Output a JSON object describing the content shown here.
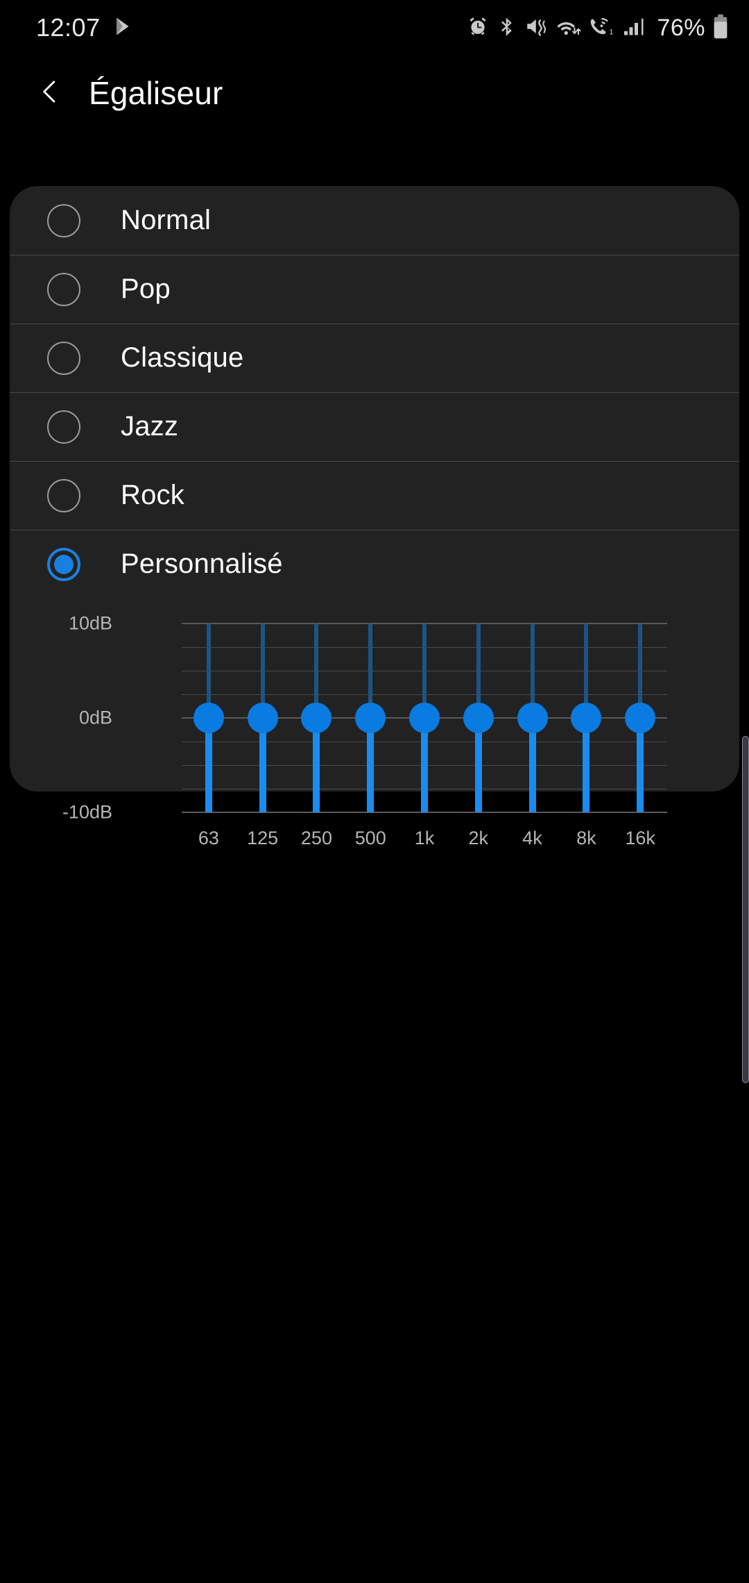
{
  "status_bar": {
    "time": "12:07",
    "battery_percent": "76%",
    "icons": [
      "play-store-icon",
      "alarm-icon",
      "bluetooth-icon",
      "vibrate-mute-icon",
      "wifi-icon",
      "wifi-calling-icon",
      "signal-bars-icon",
      "battery-icon"
    ]
  },
  "header": {
    "back_icon": "chevron-left-icon",
    "title": "Égaliseur"
  },
  "presets": {
    "items": [
      {
        "label": "Normal",
        "selected": false
      },
      {
        "label": "Pop",
        "selected": false
      },
      {
        "label": "Classique",
        "selected": false
      },
      {
        "label": "Jazz",
        "selected": false
      },
      {
        "label": "Rock",
        "selected": false
      },
      {
        "label": "Personnalisé",
        "selected": true
      }
    ],
    "selected_label": "Personnalisé",
    "accent_color": "#1a80e0"
  },
  "chart_data": {
    "type": "bar",
    "title": "",
    "xlabel": "",
    "ylabel": "dB",
    "categories": [
      "63",
      "125",
      "250",
      "500",
      "1k",
      "2k",
      "4k",
      "8k",
      "16k"
    ],
    "values": [
      0,
      0,
      0,
      0,
      0,
      0,
      0,
      0,
      0
    ],
    "ylim": [
      -10,
      10
    ],
    "ytick_labels": [
      "10dB",
      "0dB",
      "-10dB"
    ],
    "ytick_values": [
      10,
      0,
      -10
    ],
    "grid": true,
    "legend": "none",
    "units": "dB",
    "slider_color": "#1a8cf0",
    "track_color": "#1d5483",
    "grid_color": "#5a5a5a"
  }
}
